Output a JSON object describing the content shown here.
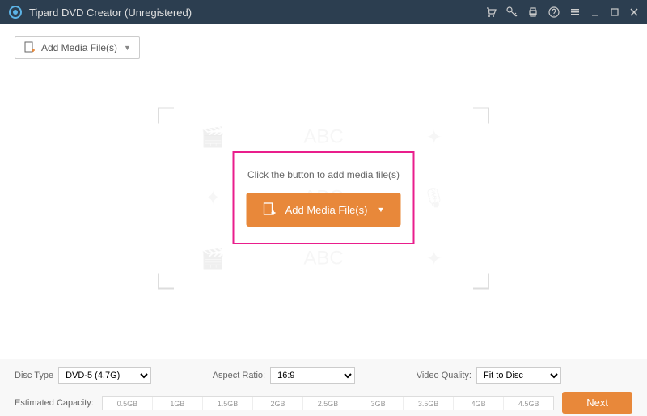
{
  "titlebar": {
    "title": "Tipard DVD Creator (Unregistered)"
  },
  "toolbar": {
    "add_media_label": "Add Media File(s)"
  },
  "dropzone": {
    "hint": "Click the button to add media file(s)",
    "add_media_label": "Add Media File(s)"
  },
  "footer": {
    "disc_type_label": "Disc Type",
    "disc_type_value": "DVD-5 (4.7G)",
    "aspect_ratio_label": "Aspect Ratio:",
    "aspect_ratio_value": "16:9",
    "video_quality_label": "Video Quality:",
    "video_quality_value": "Fit to Disc",
    "estimated_capacity_label": "Estimated Capacity:",
    "capacity_ticks": [
      "0.5GB",
      "1GB",
      "1.5GB",
      "2GB",
      "2.5GB",
      "3GB",
      "3.5GB",
      "4GB",
      "4.5GB"
    ],
    "next_label": "Next"
  }
}
